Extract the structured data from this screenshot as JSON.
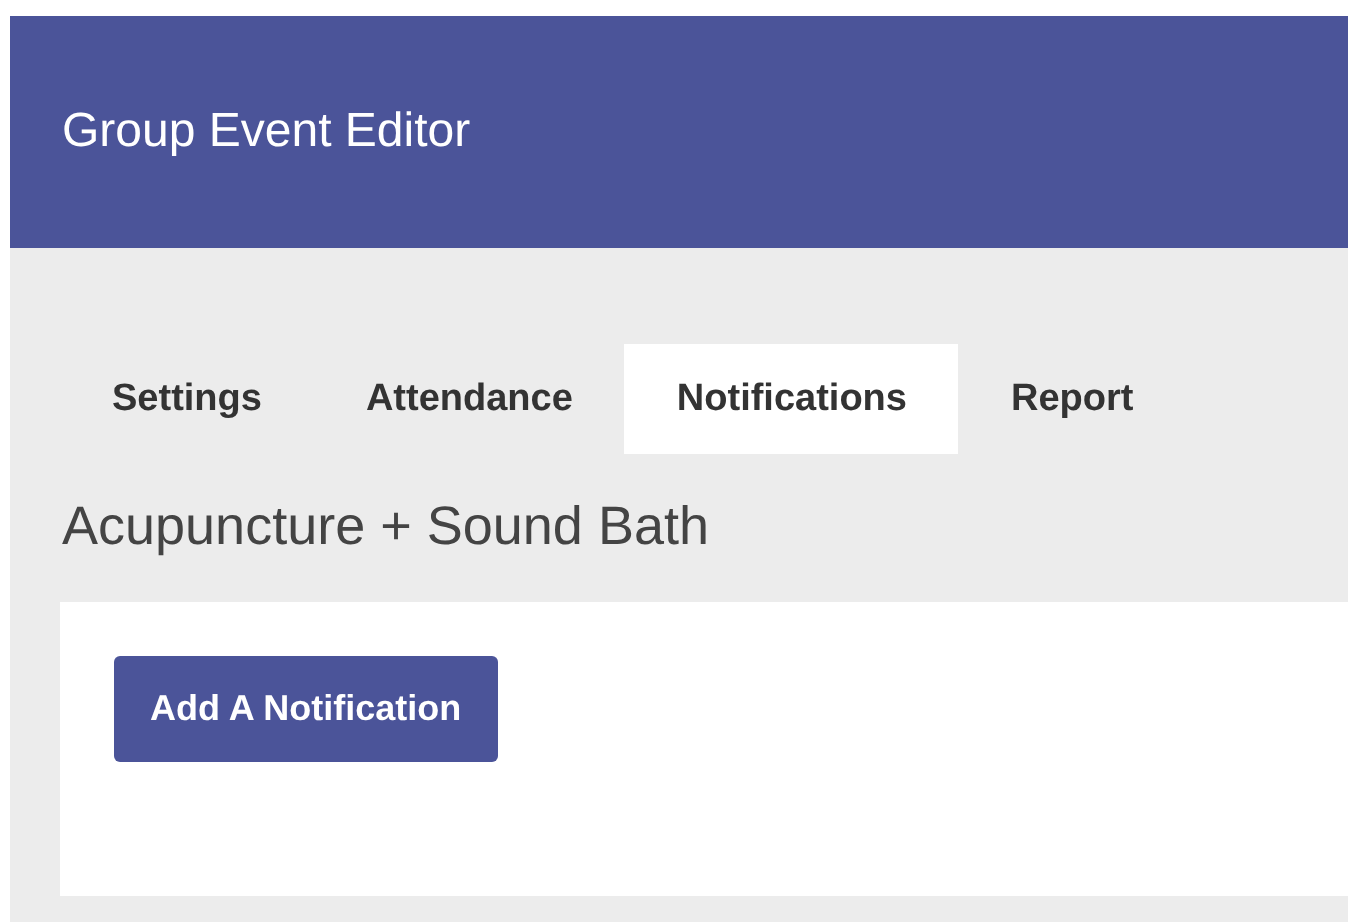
{
  "header": {
    "title": "Group Event Editor"
  },
  "tabs": [
    {
      "label": "Settings",
      "selected": false
    },
    {
      "label": "Attendance",
      "selected": false
    },
    {
      "label": "Notifications",
      "selected": true
    },
    {
      "label": "Report",
      "selected": false
    }
  ],
  "event_title": "Acupuncture + Sound Bath",
  "card": {
    "button": "Add A Notification"
  }
}
